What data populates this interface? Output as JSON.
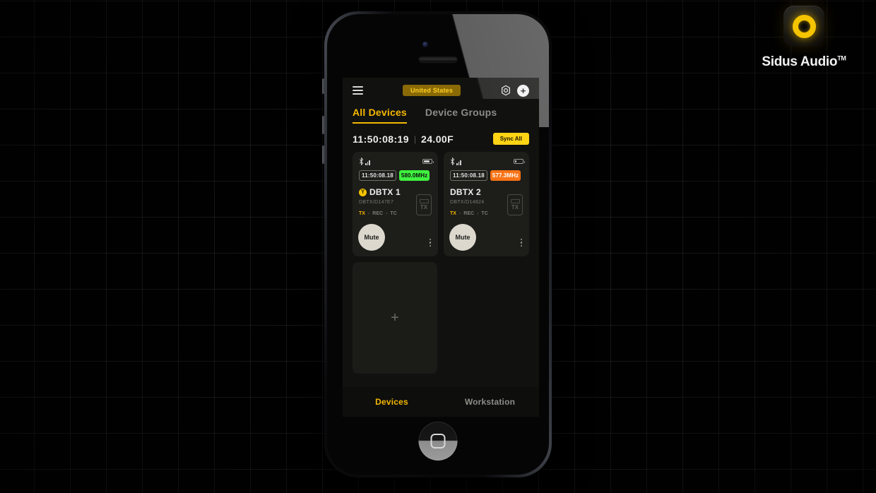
{
  "brand": {
    "name": "Sidus Audio",
    "trademark": "TM",
    "logo_icon": "ring-logo-icon",
    "accent": "#f5c400"
  },
  "app": {
    "topbar": {
      "menu_icon": "hamburger-menu-icon",
      "region_label": "United States",
      "settings_icon": "gear-icon",
      "add_icon": "plus-circle-icon"
    },
    "tabs": [
      {
        "label": "All Devices",
        "active": true
      },
      {
        "label": "Device Groups",
        "active": false
      }
    ],
    "status": {
      "clock": "11:50:08:19",
      "separator": "|",
      "temperature": "24.00F",
      "sync_label": "Sync All"
    },
    "devices": [
      {
        "bluetooth_icon": "bluetooth-icon",
        "signal_icon": "signal-bars-icon",
        "battery_icon": "battery-icon",
        "battery_level": 78,
        "timecode": "11:50:08.18",
        "frequency": "580.0MHz",
        "frequency_color": "#3ef23e",
        "badge_icon": "antenna-badge-icon",
        "badge_glyph": "Y",
        "has_badge": true,
        "name": "DBTX 1",
        "device_id": "DBTX/D147E7",
        "modes": [
          {
            "label": "TX",
            "active": true
          },
          {
            "label": "REC",
            "active": false
          },
          {
            "label": "TC",
            "active": false
          }
        ],
        "tx_icon": "transmitter-icon",
        "tx_icon_label": "TX",
        "mute_label": "Mute",
        "menu_icon": "kebab-menu-icon"
      },
      {
        "bluetooth_icon": "bluetooth-icon",
        "signal_icon": "signal-bars-icon",
        "battery_icon": "battery-icon",
        "battery_level": 8,
        "timecode": "11:50:08.18",
        "frequency": "577.3MHz",
        "frequency_color": "#f97316",
        "badge_icon": "antenna-badge-icon",
        "badge_glyph": "",
        "has_badge": false,
        "name": "DBTX 2",
        "device_id": "DBTX/D14824",
        "modes": [
          {
            "label": "TX",
            "active": true
          },
          {
            "label": "REC",
            "active": false
          },
          {
            "label": "TC",
            "active": false
          }
        ],
        "tx_icon": "transmitter-icon",
        "tx_icon_label": "TX",
        "mute_label": "Mute",
        "menu_icon": "kebab-menu-icon"
      }
    ],
    "add_device": {
      "icon": "plus-icon",
      "glyph": "+"
    },
    "bottom_nav": [
      {
        "label": "Devices",
        "active": true
      },
      {
        "label": "Workstation",
        "active": false
      }
    ]
  },
  "device_chrome": {
    "home_button": "home-button",
    "earpiece": "earpiece-speaker",
    "camera": "front-camera",
    "side_buttons": [
      "mute-switch",
      "volume-up-button",
      "volume-down-button"
    ]
  }
}
